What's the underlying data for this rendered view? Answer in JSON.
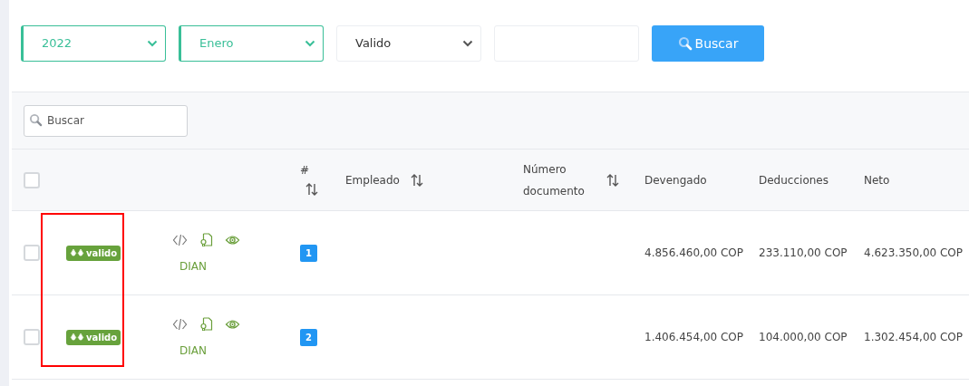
{
  "filters": [
    {
      "kind": "select",
      "value": "2022",
      "active": true
    },
    {
      "kind": "select",
      "value": "Enero",
      "active": true
    },
    {
      "kind": "select",
      "value": "Valido",
      "active": false
    },
    {
      "kind": "input"
    },
    {
      "kind": "button",
      "label": "Buscar"
    }
  ],
  "search": {
    "placeholder": "Buscar"
  },
  "table": {
    "select_all_checked": false,
    "columns": [
      {
        "label": "#",
        "sortable": true
      },
      {
        "label": "Empleado",
        "sortable": true
      },
      {
        "label": "Número documento",
        "sortable": true
      },
      {
        "label": "Devengado",
        "sortable": false
      },
      {
        "label": "Deducciones",
        "sortable": false
      },
      {
        "label": "Neto",
        "sortable": false
      }
    ],
    "rows": [
      {
        "checked": false,
        "status": "valido",
        "link": "DIAN",
        "number": "1",
        "devengado": "4.856.460,00 COP",
        "deducciones": "233.110,00 COP",
        "neto": "4.623.350,00 COP"
      },
      {
        "checked": false,
        "status": "valido",
        "link": "DIAN",
        "number": "2",
        "devengado": "1.406.454,00 COP",
        "deducciones": "104.000,00 COP",
        "neto": "1.302.454,00 COP"
      }
    ]
  }
}
